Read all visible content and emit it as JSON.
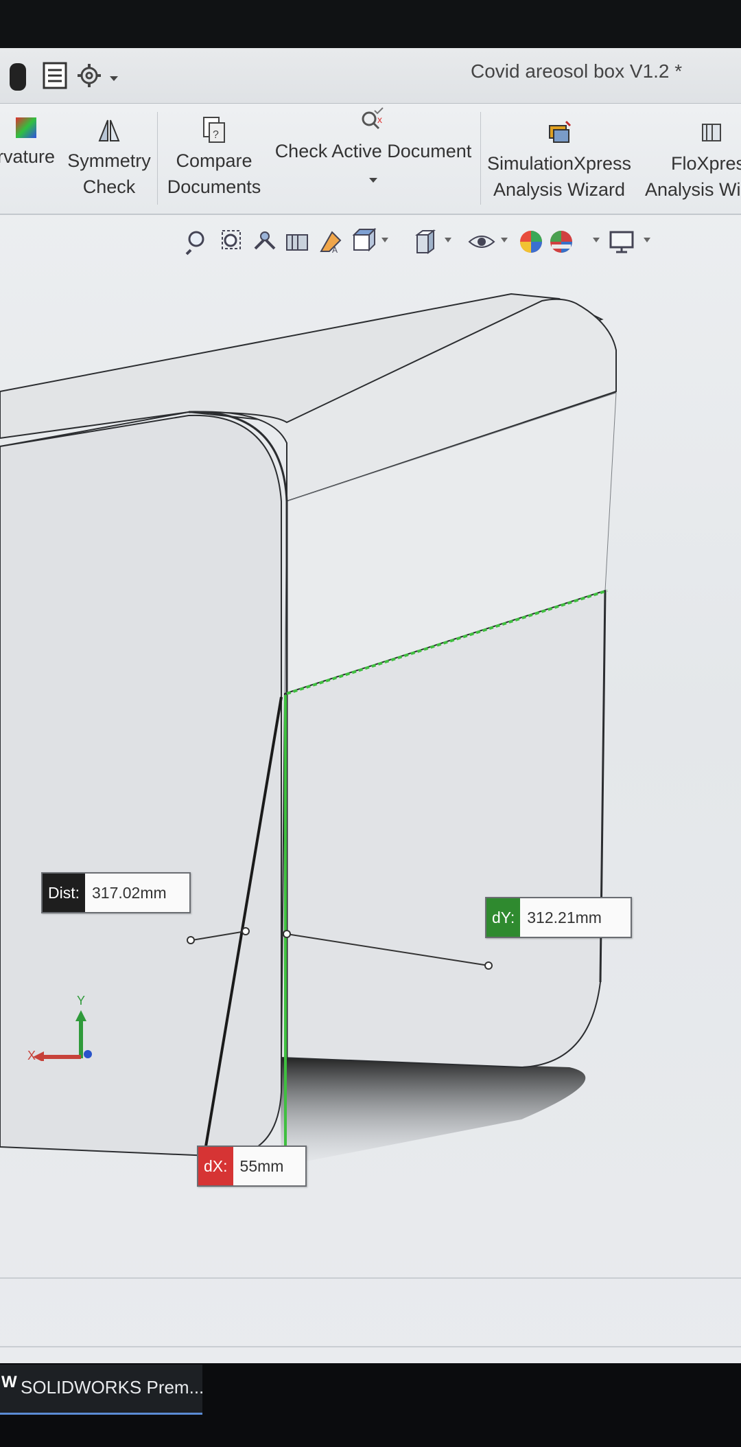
{
  "window": {
    "title": "Covid areosol box V1.2 *"
  },
  "ribbon": {
    "items": [
      {
        "line1": "rvature",
        "line2": ""
      },
      {
        "line1": "Symmetry",
        "line2": "Check"
      },
      {
        "line1": "Compare",
        "line2": "Documents"
      },
      {
        "line1": "Check Active Document",
        "line2": ""
      },
      {
        "line1": "SimulationXpress",
        "line2": "Analysis Wizard"
      },
      {
        "line1": "FloXpres",
        "line2": "Analysis Wi"
      }
    ]
  },
  "measurements": {
    "dist": {
      "label": "Dist:",
      "value": "317.02mm",
      "color": "#1e1e1e"
    },
    "dy": {
      "label": "dY:",
      "value": "312.21mm",
      "color": "#2f8a2f"
    },
    "dx": {
      "label": "dX:",
      "value": "55mm",
      "color": "#d63434"
    }
  },
  "triad": {
    "x_label": "X",
    "y_label": "Y"
  },
  "taskbar": {
    "app_label": "SOLIDWORKS Prem...",
    "app_glyph": "W"
  },
  "colors": {
    "selection_green": "#3fbf3f",
    "measure_red": "#e02a2a"
  }
}
